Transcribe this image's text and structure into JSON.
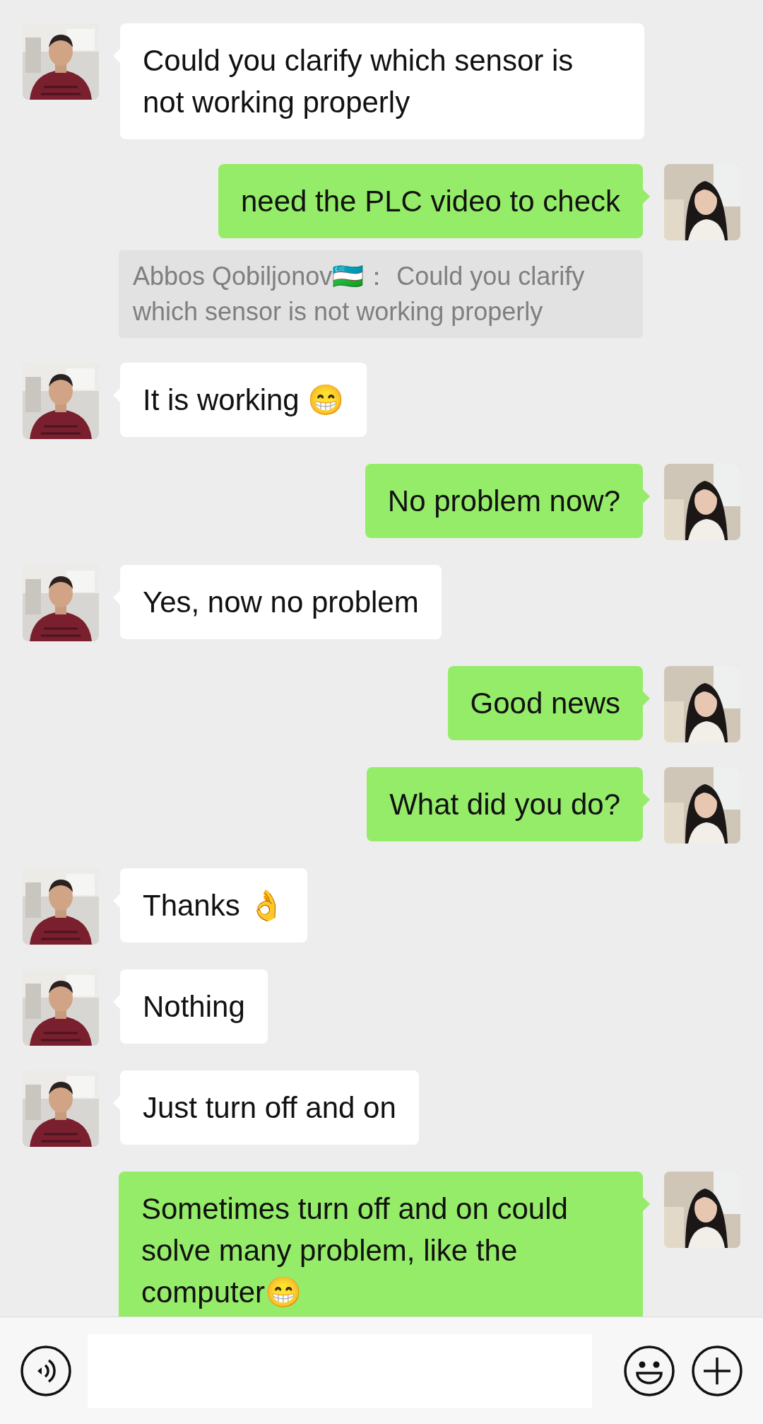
{
  "messages": [
    {
      "kind": "received",
      "text": "Could you clarify which sensor is not working properly"
    },
    {
      "kind": "sent",
      "text": "need the PLC video to check"
    },
    {
      "kind": "quote",
      "text": "Abbos Qobiljonov🇺🇿：  Could you clarify which sensor is not working properly"
    },
    {
      "kind": "received",
      "text": "It is working 😁"
    },
    {
      "kind": "sent",
      "text": "No problem now?"
    },
    {
      "kind": "received",
      "text": "Yes, now no problem"
    },
    {
      "kind": "sent",
      "text": "Good news"
    },
    {
      "kind": "sent",
      "text": "What did you do?"
    },
    {
      "kind": "received",
      "text": "Thanks 👌"
    },
    {
      "kind": "received",
      "text": "Nothing"
    },
    {
      "kind": "received",
      "text": "Just turn off and on"
    },
    {
      "kind": "sent",
      "text": "Sometimes turn off and on could solve many problem, like the computer😁"
    }
  ]
}
